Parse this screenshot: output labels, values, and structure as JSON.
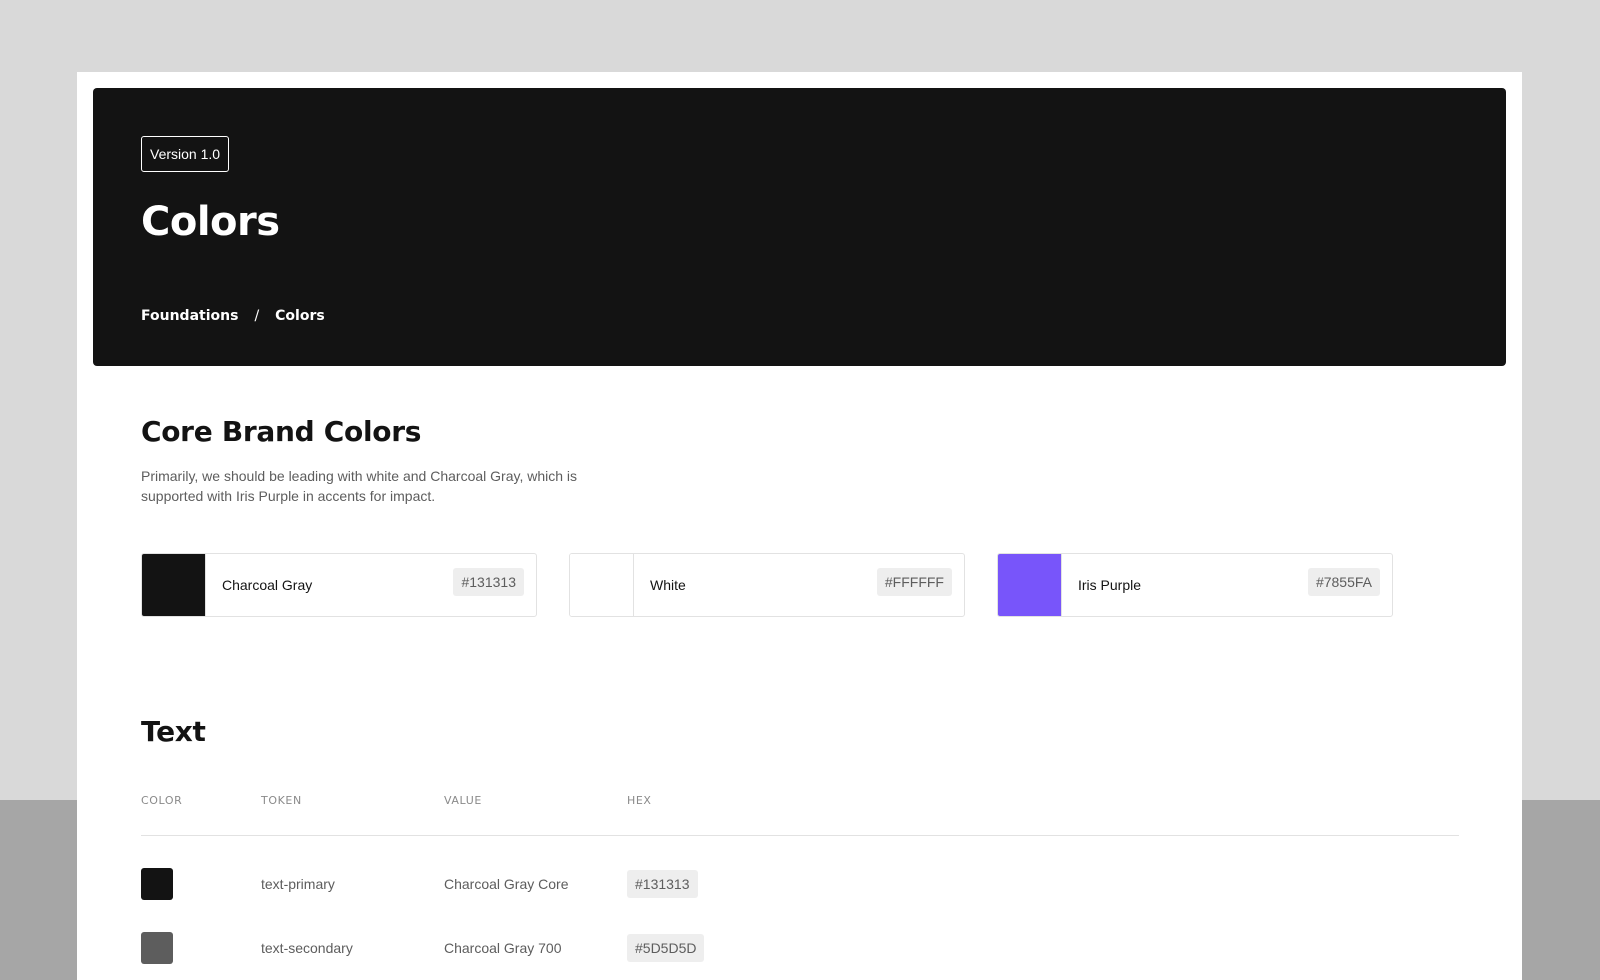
{
  "hero": {
    "version": "Version 1.0",
    "title": "Colors",
    "breadcrumb": {
      "parent": "Foundations",
      "separator": "/",
      "current": "Colors"
    }
  },
  "core": {
    "title": "Core Brand Colors",
    "description": "Primarily, we should be leading with white and Charcoal Gray, which is supported with Iris Purple in accents for impact.",
    "swatches": [
      {
        "name": "Charcoal Gray",
        "hex": "#131313",
        "color": "#131313"
      },
      {
        "name": "White",
        "hex": "#FFFFFF",
        "color": "#FFFFFF"
      },
      {
        "name": "Iris Purple",
        "hex": "#7855FA",
        "color": "#7855FA"
      }
    ]
  },
  "text_section": {
    "title": "Text",
    "headers": {
      "color": "COLOR",
      "token": "TOKEN",
      "value": "VALUE",
      "hex": "HEX"
    },
    "rows": [
      {
        "color": "#131313",
        "token": "text-primary",
        "value": "Charcoal Gray Core",
        "hex": "#131313"
      },
      {
        "color": "#5D5D5D",
        "token": "text-secondary",
        "value": "Charcoal Gray 700",
        "hex": "#5D5D5D"
      }
    ]
  }
}
